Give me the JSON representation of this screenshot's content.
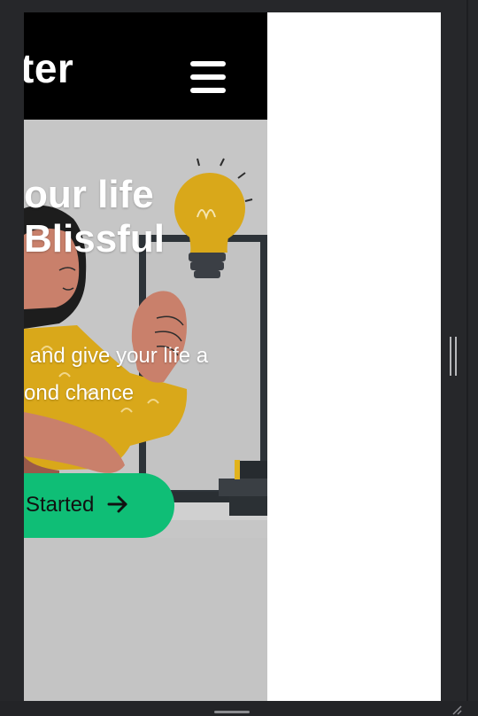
{
  "site": {
    "brand": "ter",
    "menu_icon": "hamburger-menu-icon"
  },
  "hero": {
    "title": "our life\nBlissful",
    "subtitle": " and give your life a\nond chance",
    "cta_label": "Started",
    "cta_icon": "arrow-right-icon"
  },
  "colors": {
    "navbar": "#000000",
    "cta": "#0fbe76",
    "hero_bg": "#c7c7c7",
    "accent_yellow": "#d9a81a"
  }
}
